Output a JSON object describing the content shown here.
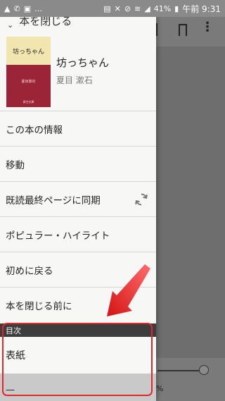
{
  "status_bar": {
    "time": "午前 9:31",
    "battery": "41%",
    "icons": [
      "warning-icon",
      "notification-icon",
      "image-icon",
      "more-icon",
      "sim-icon",
      "mute-icon",
      "no-wifi-icon",
      "wifi-icon",
      "signal-icon",
      "battery-icon"
    ]
  },
  "drawer": {
    "header_title": "本を閉じる",
    "book": {
      "title": "坊っちゃん",
      "author": "夏目 漱石",
      "cover_title": "坊っちゃん",
      "cover_author": "夏目漱石",
      "cover_publisher": "青空文庫"
    },
    "menu_items": [
      {
        "label": "この本の情報"
      },
      {
        "label": "移動"
      },
      {
        "label": "既読最終ページに同期",
        "icon": "sync-icon"
      },
      {
        "label": "ポピュラー・ハイライト"
      },
      {
        "label": "初めに戻る"
      },
      {
        "label": "本を閉じる前に"
      }
    ],
    "toc_header": "目次",
    "toc_items": [
      {
        "label": "表紙"
      },
      {
        "label": "—"
      }
    ]
  },
  "reader": {
    "percent": "%"
  },
  "colors": {
    "annotation": "#e32626",
    "drawer_bg": "#f7f7f5",
    "toc_header_bg": "#3d3d3d",
    "cover_red": "#9b2436"
  }
}
